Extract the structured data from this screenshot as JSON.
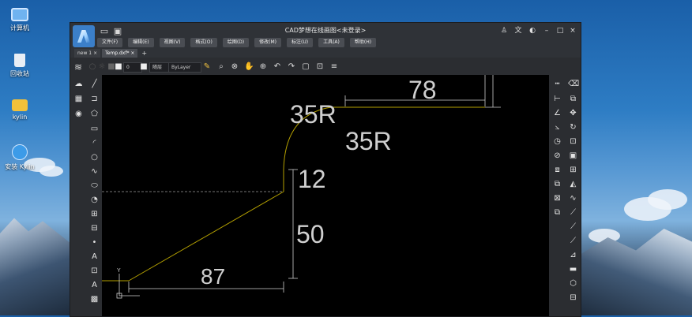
{
  "desktop": {
    "icons": [
      {
        "label": "计算机",
        "icon": "computer-icon"
      },
      {
        "label": "回收站",
        "icon": "trash-icon"
      },
      {
        "label": "kylin",
        "icon": "folder-icon"
      },
      {
        "label": "安装 Kylin",
        "icon": "installer-icon"
      }
    ]
  },
  "window": {
    "title": "CAD梦想在线画图<未登录>",
    "menu": [
      "文件(F)",
      "编辑(E)",
      "视图(V)",
      "格式(O)",
      "绘图(D)",
      "修改(M)",
      "标注(U)",
      "工具(A)",
      "帮助(H)"
    ],
    "tabs": [
      {
        "label": "new 1",
        "closable": true
      },
      {
        "label": "Temp.dxf*",
        "closable": true,
        "active": true
      }
    ],
    "tab_add": "+",
    "tab_close": "×",
    "window_controls": {
      "user": "user-icon",
      "translate": "translate-icon",
      "theme": "theme-icon",
      "minimize": "–",
      "maximize": "□",
      "close": "×"
    }
  },
  "toolbar": {
    "layer_value": "0",
    "color_value": "随层",
    "linetype_value": "ByLayer"
  },
  "drawing": {
    "dimensions": [
      "78",
      "35R",
      "35R",
      "12",
      "50",
      "87"
    ],
    "ucs_label": "Y",
    "colors": {
      "line": "#b4a000",
      "dim": "#cfcfcf",
      "center": "#9a9a9a",
      "background": "#000000"
    }
  }
}
